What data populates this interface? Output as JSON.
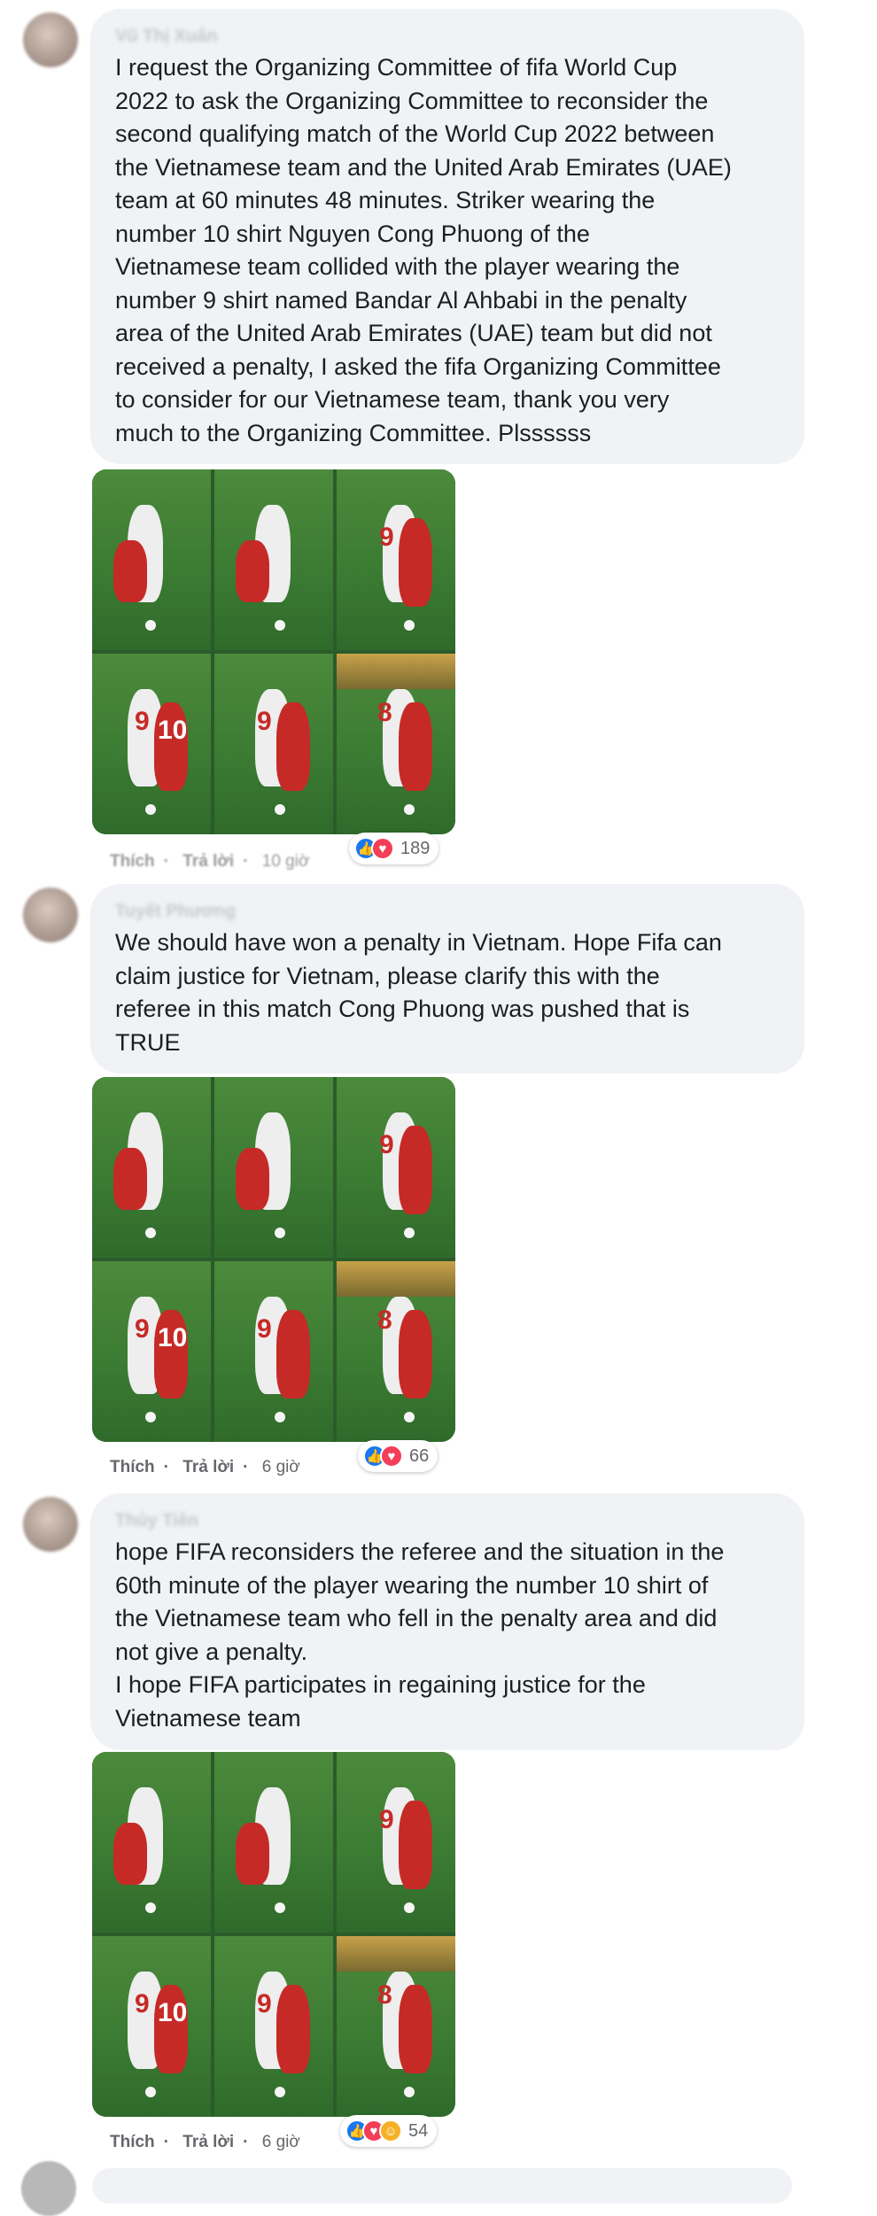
{
  "comments": [
    {
      "author": "Vũ Thị Xuân",
      "text": "I request the Organizing Committee of fifa World Cup\n2022 to ask the Organizing Committee to reconsider the\nsecond qualifying match of the World Cup 2022 between\nthe Vietnamese team and the United Arab Emirates (UAE)\nteam at 60 minutes 48 minutes. Striker wearing the\nnumber 10 shirt Nguyen Cong Phuong of the\nVietnamese team collided with the player wearing the\nnumber 9 shirt named Bandar Al Ahbabi in the penalty\narea of the United Arab Emirates (UAE) team but did not\nreceived a penalty, I asked the fifa Organizing Committee\nto consider for our Vietnamese team, thank you very\nmuch to the Organizing Committee. Plssssss",
      "like_label": "Thích",
      "reply_label": "Trả lời",
      "time": "10 giờ",
      "reaction_count": "189",
      "reactions": [
        "like-icon",
        "love-icon"
      ]
    },
    {
      "author": "Tuyết Phương",
      "text": "We should have won a penalty in Vietnam. Hope Fifa can\nclaim justice for Vietnam, please clarify this with the\nreferee in this match Cong Phuong was pushed that is\nTRUE",
      "like_label": "Thích",
      "reply_label": "Trả lời",
      "time": "6 giờ",
      "reaction_count": "66",
      "reactions": [
        "like-icon",
        "love-icon"
      ]
    },
    {
      "author": "Thủy Tiên",
      "text": "hope FIFA reconsiders the referee and the situation in the\n60th minute of the player wearing the number 10 shirt of\nthe Vietnamese team who fell in the penalty area and did\nnot give a penalty.\nI hope FIFA participates in regaining justice for the\nVietnamese team",
      "like_label": "Thích",
      "reply_label": "Trả lời",
      "time": "6 giờ",
      "reaction_count": "54",
      "reactions": [
        "like-icon",
        "love-icon",
        "care-icon"
      ]
    }
  ],
  "photo_numbers": {
    "white_player": "9",
    "red_player": "10",
    "uae_player": "8"
  },
  "colors": {
    "bubble": "#f0f2f5",
    "like": "#1877f2",
    "love": "#f33e58",
    "care": "#f7b125",
    "meta": "#65676b"
  }
}
